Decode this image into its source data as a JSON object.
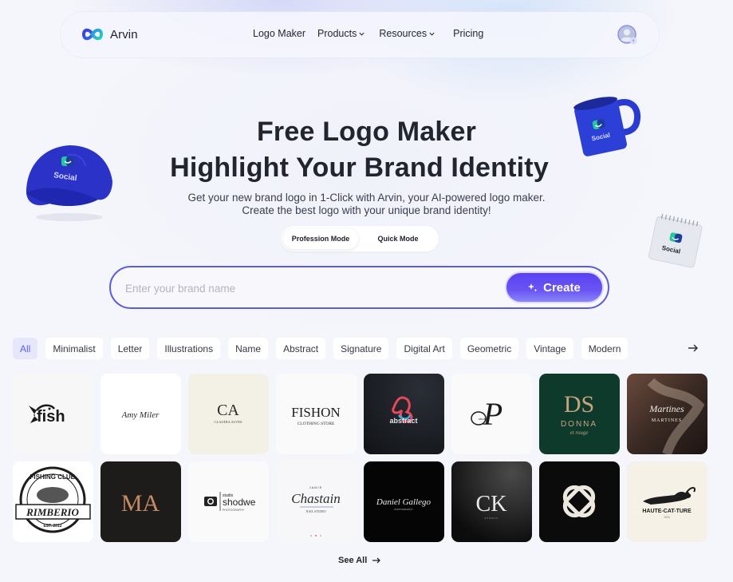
{
  "nav": {
    "brand_name": "Arvin",
    "links": [
      {
        "label": "Logo Maker",
        "has_dropdown": false
      },
      {
        "label": "Products",
        "has_dropdown": true
      },
      {
        "label": "Resources",
        "has_dropdown": true
      },
      {
        "label": "Pricing",
        "has_dropdown": false
      }
    ],
    "avatar_icon": "user-avatar-icon"
  },
  "hero": {
    "title_line1": "Free Logo Maker",
    "title_line2": "Highlight Your Brand Identity",
    "subtitle_line1": "Get your new brand logo in 1-Click with Arvin, your AI-powered logo maker.",
    "subtitle_line2": "Create the best logo with your unique brand identity!",
    "modes": [
      {
        "label": "Profession Mode",
        "selected": true
      },
      {
        "label": "Quick Mode",
        "selected": false
      }
    ],
    "search": {
      "placeholder": "Enter your brand name",
      "value": ""
    },
    "create_label": "Create",
    "decor_brand_text": "Social"
  },
  "filters": {
    "items": [
      {
        "label": "All",
        "active": true
      },
      {
        "label": "Minimalist",
        "active": false
      },
      {
        "label": "Letter",
        "active": false
      },
      {
        "label": "Illustrations",
        "active": false
      },
      {
        "label": "Name",
        "active": false
      },
      {
        "label": "Abstract",
        "active": false
      },
      {
        "label": "Signature",
        "active": false
      },
      {
        "label": "Digital Art",
        "active": false
      },
      {
        "label": "Geometric",
        "active": false
      },
      {
        "label": "Vintage",
        "active": false
      },
      {
        "label": "Modern",
        "active": false
      }
    ]
  },
  "gallery": {
    "tiles": [
      {
        "name": "fish",
        "text": "fish",
        "bg": "#f7f7f7",
        "fg": "#1a1a1a"
      },
      {
        "name": "amy-miler",
        "text": "Amy Miler",
        "bg": "#ffffff",
        "fg": "#2a2a2a"
      },
      {
        "name": "claudia-alves",
        "text": "CA",
        "subtext": "CLAUDIA ALVES",
        "bg": "#f3f1e6",
        "fg": "#2b2b2b"
      },
      {
        "name": "fishon",
        "text": "FISHON",
        "subtext": "CLOTHING STORE",
        "bg": "#fafafb",
        "fg": "#1b1b1b"
      },
      {
        "name": "abstract",
        "text": "abstract",
        "bg": "#16181d",
        "fg": "#e5e7ea"
      },
      {
        "name": "studio-p",
        "text": "P",
        "subtext": "studio",
        "bg": "#fafafa",
        "fg": "#1a1a1a"
      },
      {
        "name": "donna",
        "text": "DS",
        "subtext": "DONNA",
        "subtext2": "et rouge",
        "bg": "#0e3a2c",
        "fg": "#c9a27e"
      },
      {
        "name": "martines",
        "text": "Martines",
        "subtext": "MARTINES",
        "bg": "#2c2220",
        "fg": "#f0ece6"
      },
      {
        "name": "fishing-club",
        "text": "RIMBERIO",
        "subtext": "FISHING CLUB",
        "subtext2": "EST. 2012",
        "bg": "#ffffff",
        "fg": "#1d1d1d"
      },
      {
        "name": "ma-monogram",
        "text": "MA",
        "bg": "#1d1c1b",
        "fg": "#c68a63"
      },
      {
        "name": "shodwe",
        "text": "shodwe",
        "subtext": "studio",
        "subtext2": "PHOTOGRAPHY",
        "bg": "#fafafa",
        "fg": "#222"
      },
      {
        "name": "chastain",
        "text": "Chastain",
        "subtext": "JAMIE",
        "subtext2": "NAIL STUDIO",
        "bg": "#f7f7f9",
        "fg": "#2a2a2a"
      },
      {
        "name": "daniel-gallego",
        "text": "Daniel Gallego",
        "subtext": "PHOTOGRAPHY",
        "bg": "#050505",
        "fg": "#e8e8e8"
      },
      {
        "name": "ck-monogram",
        "text": "CK",
        "subtext": "STUDIO",
        "bg": "#101010",
        "fg": "#e8e8e8"
      },
      {
        "name": "knot",
        "text": "",
        "bg": "#0c0b0b",
        "fg": "#ece8df"
      },
      {
        "name": "haute-cat-ture",
        "text": "HAUTE-CAT-TURE",
        "subtext": "1924",
        "bg": "#f5f1e6",
        "fg": "#1d1d1d"
      }
    ]
  },
  "footer": {
    "see_all_label": "See All"
  },
  "colors": {
    "accent": "#5b5ce0",
    "create_gradient_top": "#5a41f0",
    "active_chip_bg": "#e6e7fb",
    "active_chip_text": "#5b5df0"
  }
}
